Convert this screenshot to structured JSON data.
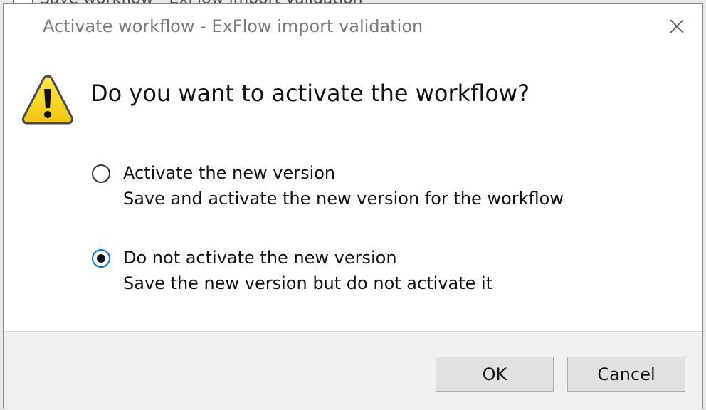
{
  "background_window": {
    "title": "Save workflow - ExFlow import validation"
  },
  "dialog": {
    "title": "Activate workflow - ExFlow import validation",
    "close_icon": "close-icon",
    "warning_icon": "warning-icon",
    "question": "Do you want to activate the workflow?",
    "options": [
      {
        "label": "Activate the new version",
        "description": "Save and activate the new version for the workflow",
        "selected": false
      },
      {
        "label": "Do not activate the new version",
        "description": "Save the new version but do not activate it",
        "selected": true
      }
    ],
    "buttons": {
      "ok_label": "OK",
      "cancel_label": "Cancel"
    }
  },
  "colors": {
    "radio_selected_border": "#0078d7",
    "footer_bg": "#f0f0f0",
    "warning_yellow": "#f4d21f"
  }
}
